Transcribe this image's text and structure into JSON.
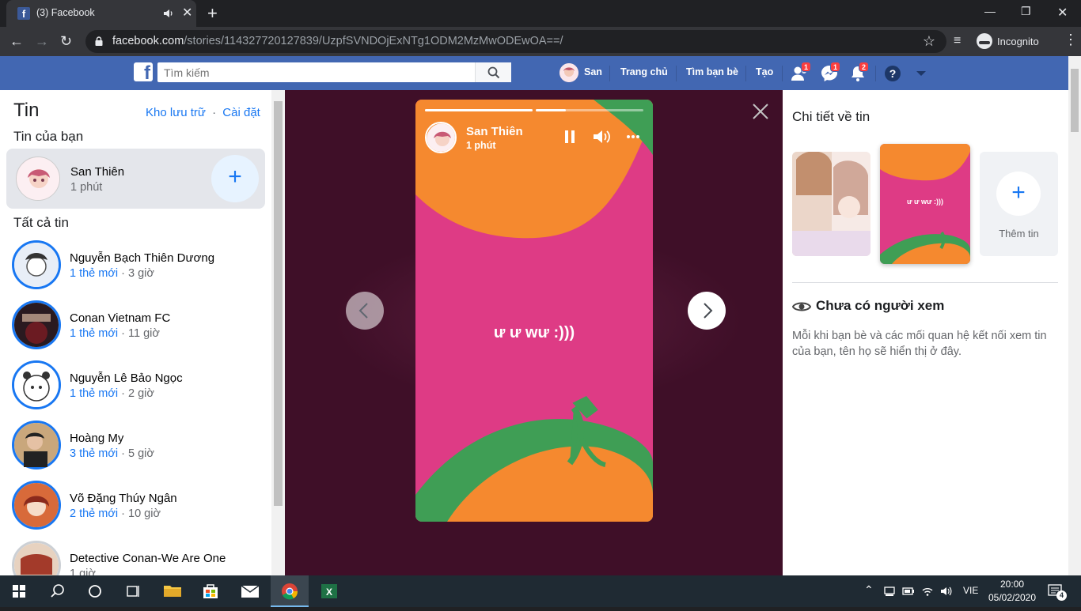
{
  "browser": {
    "tab_title": "(3) Facebook",
    "url_host": "facebook.com",
    "url_path": "/stories/114327720127839/UzpfSVNDOjExNTg1ODM2MzMwODEwOA==/",
    "incognito_label": "Incognito"
  },
  "fb": {
    "search_placeholder": "Tìm kiếm",
    "user_name": "San",
    "nav_home": "Trang chủ",
    "nav_find_friends": "Tìm bạn bè",
    "nav_create": "Tạo",
    "badge_friends": "1",
    "badge_messenger": "1",
    "badge_notifications": "2",
    "brand_color": "#4267b2"
  },
  "left": {
    "title": "Tin",
    "archive_link": "Kho lưu trữ",
    "separator": "·",
    "settings_link": "Cài đặt",
    "your_story_heading": "Tin của bạn",
    "my_story": {
      "name": "San Thiên",
      "time": "1 phút"
    },
    "all_stories_heading": "Tất cả tin",
    "stories": [
      {
        "name": "Nguyễn Bạch Thiên Dương",
        "new": "1 thẻ mới",
        "dot": "·",
        "time": "3 giờ"
      },
      {
        "name": "Conan Vietnam FC",
        "new": "1 thẻ mới",
        "dot": "·",
        "time": "11 giờ"
      },
      {
        "name": "Nguyễn Lê Bảo Ngọc",
        "new": "1 thẻ mới",
        "dot": "·",
        "time": "2 giờ"
      },
      {
        "name": "Hoàng My",
        "new": "3 thẻ mới",
        "dot": "·",
        "time": "5 giờ"
      },
      {
        "name": "Võ Đặng Thúy Ngân",
        "new": "2 thẻ mới",
        "dot": "·",
        "time": "10 giờ"
      },
      {
        "name": "Detective Conan-We Are One",
        "new": "",
        "dot": "",
        "time": "1 giờ"
      }
    ]
  },
  "story": {
    "author": "San Thiên",
    "time": "1 phút",
    "text": "ư ư wư :)))",
    "progress": [
      1.0,
      0.28
    ],
    "background_color": "#de3b85",
    "shape_colors": [
      "#f5892f",
      "#3f9e55"
    ]
  },
  "right": {
    "title": "Chi tiết về tin",
    "thumb_text": "ư ư wư :)))",
    "add_label": "Thêm tin",
    "viewers_heading": "Chưa có người xem",
    "viewers_desc": "Mỗi khi bạn bè và các mối quan hệ kết nối xem tin của bạn, tên họ sẽ hiển thị ở đây."
  },
  "taskbar": {
    "language": "VIE",
    "time": "20:00",
    "date": "05/02/2020",
    "notifications": "4"
  }
}
